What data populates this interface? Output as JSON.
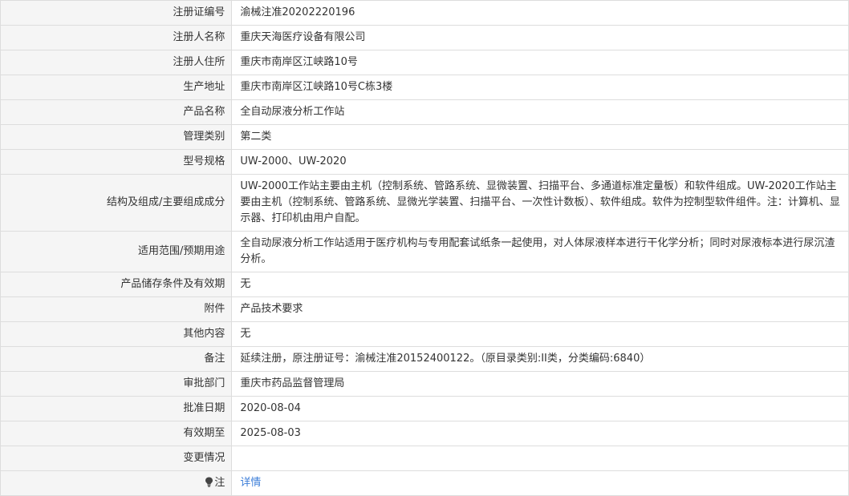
{
  "rows": [
    {
      "label": "注册证编号",
      "value": "渝械注准20202220196"
    },
    {
      "label": "注册人名称",
      "value": "重庆天海医疗设备有限公司"
    },
    {
      "label": "注册人住所",
      "value": "重庆市南岸区江峡路10号"
    },
    {
      "label": "生产地址",
      "value": "重庆市南岸区江峡路10号C栋3楼"
    },
    {
      "label": "产品名称",
      "value": "全自动尿液分析工作站"
    },
    {
      "label": "管理类别",
      "value": "第二类"
    },
    {
      "label": "型号规格",
      "value": "UW-2000、UW-2020"
    },
    {
      "label": "结构及组成/主要组成成分",
      "value": "UW-2000工作站主要由主机（控制系统、管路系统、显微装置、扫描平台、多通道标准定量板）和软件组成。UW-2020工作站主要由主机（控制系统、管路系统、显微光学装置、扫描平台、一次性计数板）、软件组成。软件为控制型软件组件。注：计算机、显示器、打印机由用户自配。"
    },
    {
      "label": "适用范围/预期用途",
      "value": "全自动尿液分析工作站适用于医疗机构与专用配套试纸条一起使用，对人体尿液样本进行干化学分析；同时对尿液标本进行尿沉渣分析。"
    },
    {
      "label": "产品储存条件及有效期",
      "value": "无"
    },
    {
      "label": "附件",
      "value": "产品技术要求"
    },
    {
      "label": "其他内容",
      "value": "无"
    },
    {
      "label": "备注",
      "value": "延续注册，原注册证号：渝械注准20152400122。（原目录类别:II类，分类编码:6840）"
    },
    {
      "label": "审批部门",
      "value": "重庆市药品监督管理局"
    },
    {
      "label": "批准日期",
      "value": "2020-08-04"
    },
    {
      "label": "有效期至",
      "value": "2025-08-03"
    },
    {
      "label": "变更情况",
      "value": ""
    },
    {
      "label": "注",
      "value": "详情",
      "icon": "lightbulb-icon"
    }
  ]
}
